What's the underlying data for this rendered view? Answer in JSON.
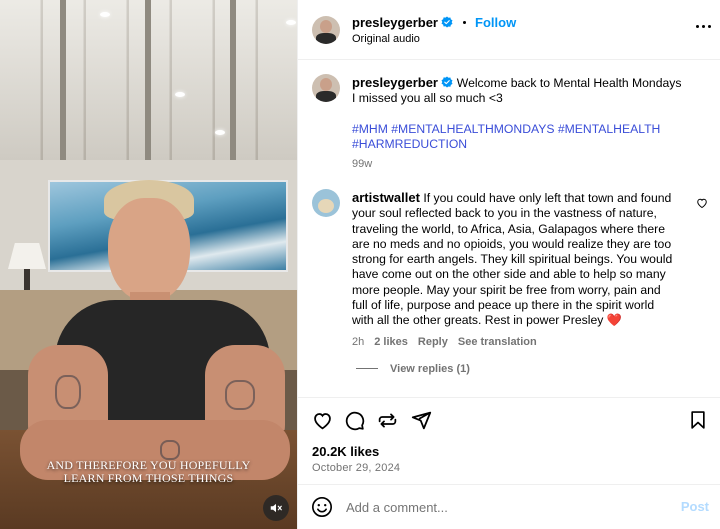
{
  "header": {
    "username": "presleygerber",
    "follow_label": "Follow",
    "audio_label": "Original audio"
  },
  "video": {
    "caption_line1": "AND THEREFORE YOU HOPEFULLY",
    "caption_line2": "LEARN FROM THOSE THINGS"
  },
  "post_caption": {
    "username": "presleygerber",
    "text_line1": "Welcome back to Mental Health Mondays",
    "text_line2": "I missed you all so much <3",
    "hashtags_line1": "#MHM #MENTALHEALTHMONDAYS #MENTALHEALTH",
    "hashtags_line2": "#HARMREDUCTION",
    "age": "99w"
  },
  "comment": {
    "username": "artistwallet",
    "lines": [
      "If you could have only left that town and found",
      "your soul reflected back to you in the vastness of nature,",
      "traveling the world, to Africa, Asia, Galapagos where there",
      "are no meds and no opioids, you would realize they are too",
      "strong for earth angels. They kill spiritual beings. You would",
      "have come out on the other side and able to help so many",
      "more people. May your spirit be free from worry, pain and",
      "full of life, purpose and peace up there in the spirit world",
      "with all the other greats. Rest in power Presley ❤️"
    ],
    "age": "2h",
    "likes": "2 likes",
    "reply_label": "Reply",
    "translate_label": "See translation",
    "view_replies": "View replies (1)"
  },
  "engagement": {
    "likes": "20.2K likes",
    "date": "October 29, 2024"
  },
  "add_comment": {
    "placeholder": "Add a comment...",
    "post_label": "Post"
  },
  "colors": {
    "link_blue": "#0095f6",
    "hashtag_blue": "#3b4ed8",
    "muted_gray": "#737373",
    "heart_red": "#e0245e"
  },
  "icons": [
    "verified-badge-icon",
    "more-options-icon",
    "heart-icon",
    "comment-icon",
    "share-icon",
    "send-icon",
    "bookmark-icon",
    "emoji-icon",
    "mute-icon"
  ]
}
